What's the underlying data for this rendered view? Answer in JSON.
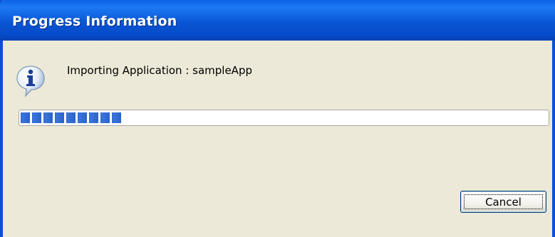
{
  "window": {
    "title": "Progress Information"
  },
  "message": {
    "icon": "info-icon",
    "text": "Importing Application : sampleApp"
  },
  "progress": {
    "fraction": 0.2
  },
  "buttons": {
    "cancel_label": "Cancel"
  },
  "colors": {
    "titlebar": "#0a56d6",
    "dialog_bg": "#ece9d8",
    "progress_fill": "#2c62c8"
  }
}
